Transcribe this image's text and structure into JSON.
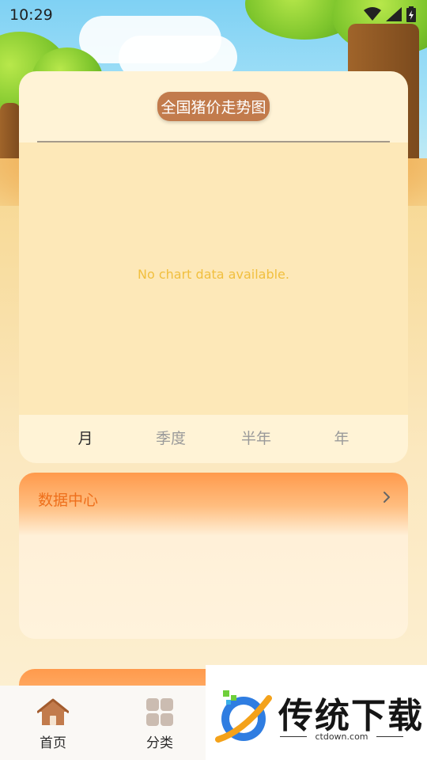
{
  "status_bar": {
    "time": "10:29"
  },
  "chart_card": {
    "title": "全国猪价走势图",
    "empty_message": "No chart data available.",
    "tabs": [
      {
        "label": "月",
        "active": true
      },
      {
        "label": "季度",
        "active": false
      },
      {
        "label": "半年",
        "active": false
      },
      {
        "label": "年",
        "active": false
      }
    ]
  },
  "data_center": {
    "title": "数据中心"
  },
  "bottom_nav": {
    "items": [
      {
        "label": "首页",
        "icon": "home-icon"
      },
      {
        "label": "分类",
        "icon": "grid-icon"
      }
    ]
  },
  "watermark": {
    "brand": "传统下载",
    "site": "ctdown.com"
  },
  "colors": {
    "accent_orange": "#ee6f1b",
    "title_badge": "#c27b4c",
    "empty_text": "#f1bf3e",
    "card_bg": "#fff3d6"
  }
}
